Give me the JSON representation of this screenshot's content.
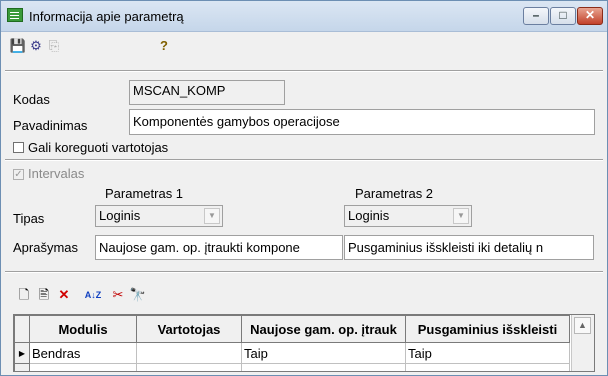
{
  "window": {
    "title": "Informacija apie parametrą",
    "min_glyph": "–",
    "max_glyph": "□",
    "close_glyph": "✕"
  },
  "toolbar": {
    "save_icon": "💾",
    "tree_icon": "⚙",
    "copy_icon": "⎘",
    "help_icon": "?"
  },
  "form": {
    "kodas_label": "Kodas",
    "kodas_value": "MSCAN_KOMP",
    "pavadinimas_label": "Pavadinimas",
    "pavadinimas_value": "Komponentės gamybos operacijose",
    "gali_label": "Gali koreguoti vartotojas",
    "gali_checked": false,
    "intervalas_label": "Intervalas",
    "intervalas_checked": true,
    "param1_header": "Parametras 1",
    "param2_header": "Parametras 2",
    "tipas_label": "Tipas",
    "tipas1_value": "Loginis",
    "tipas2_value": "Loginis",
    "aprasymas_label": "Aprašymas",
    "aprasymas1_value": "Naujose gam. op. įtraukti kompone",
    "aprasymas2_value": "Pusgaminius išskleisti iki detalių n"
  },
  "grid_toolbar": {
    "new_icon": "🗋",
    "edit_icon": "🖹",
    "delete_icon": "✕",
    "sort_icon": "A↓Z",
    "filter_icon": "✂",
    "find_icon": "🔭"
  },
  "grid": {
    "columns": [
      "Modulis",
      "Vartotojas",
      "Naujose gam. op. įtrauk",
      "Pusgaminius išskleisti"
    ],
    "rows": [
      [
        "Bendras",
        "",
        "Taip",
        "Taip"
      ]
    ],
    "row_marker": "▶",
    "scroll_up": "▲"
  }
}
